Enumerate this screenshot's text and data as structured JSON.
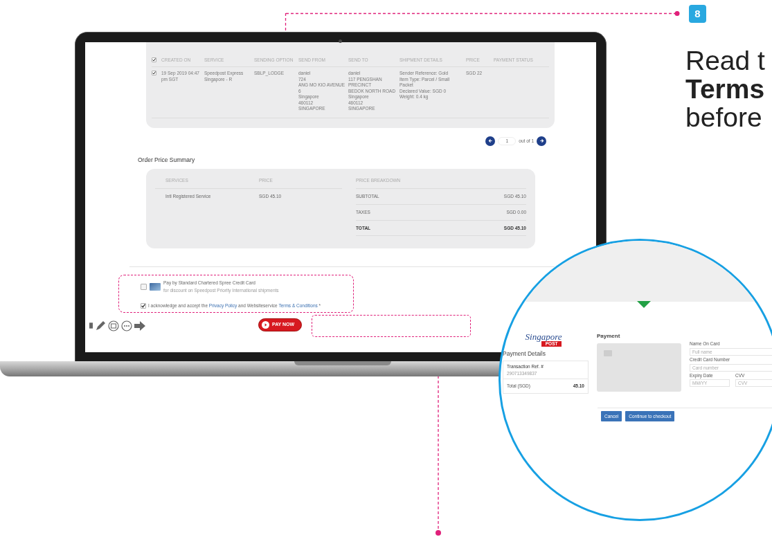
{
  "step_badge": "8",
  "instruction": "Read t\n**Terms**\nbefore",
  "shipments_table": {
    "header_checked": true,
    "columns": [
      "CREATED ON",
      "SERVICE",
      "SENDING OPTION",
      "SEND FROM",
      "SEND TO",
      "SHIPMENT DETAILS",
      "PRICE",
      "PAYMENT STATUS"
    ],
    "rows": [
      {
        "checked": true,
        "cells": [
          "19 Sep 2019 04:47 pm SGT",
          "Speedpost Express Singapore - R",
          "SBLP_LODGE",
          "daniel\n724\nANG MO KIO AVENUE 6\nSingapore\n460112\nSINGAPORE",
          "daniel\n117 PENGSHAN\nPRECINCT\nBEDOK NORTH ROAD\nSingapore\n460112\nSINGAPORE",
          "Sender Reference: Gold\nItem Type: Parcel / Small Packet\nDeclared Value: SGD 0\nWeight: 0.4 kg",
          "SGD 22"
        ]
      }
    ]
  },
  "pagination": {
    "page": "1",
    "label": "out of 1"
  },
  "order_price_summary": {
    "title": "Order Price Summary",
    "columns": [
      "SERVICES",
      "PRICE",
      "PRICE BREAKDOWN"
    ],
    "service": "Intl Registered Service",
    "price": "SGD 45.10",
    "breakdown": [
      {
        "kind": "line",
        "label": "SUBTOTAL",
        "value": "SGD 45.10"
      },
      {
        "kind": "line",
        "label": "TAXES",
        "value": "SGD 0.00"
      },
      {
        "kind": "total",
        "label": "TOTAL",
        "value": "SGD 45.10"
      }
    ]
  },
  "payment_options": [
    {
      "kind": "card_offer",
      "checked": false,
      "title": "Pay by Standard Chartered Spree Credit Card",
      "subtitle": "for discount on Speedpost Priority International shipments"
    },
    {
      "kind": "acknowledge",
      "checked": true,
      "before": "I acknowledge and accept the",
      "link_1": "Privacy Policy",
      "middle": "and Websiteservice",
      "link_2": "Terms & Conditions",
      "after": "*"
    }
  ],
  "pay_button": "PAY NOW",
  "payment_modal": {
    "logo_script": "Singapore",
    "logo_badge": "POST",
    "details_title": "Payment Details",
    "transaction_label": "Transaction Ref. #",
    "transaction_value": "290713349837",
    "total_label": "Total (SGD)",
    "total_value": "45.10",
    "title": "Payment",
    "fields": [
      {
        "label": "Name On Card",
        "placeholder": "Full name"
      },
      {
        "label": "Credit Card Number",
        "placeholder": "Card number"
      },
      {
        "label": "Expiry Date",
        "placeholder": "MM/YY"
      },
      {
        "label": "CVV",
        "placeholder": "CVV"
      }
    ],
    "buttons": [
      "Cancel",
      "Continue to checkout"
    ]
  }
}
